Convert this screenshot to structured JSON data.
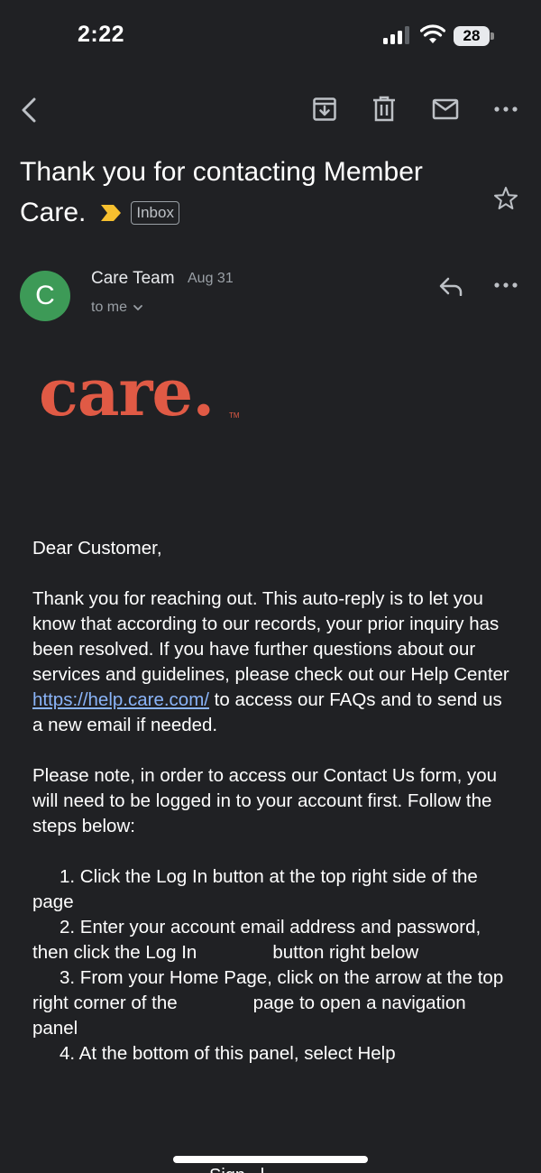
{
  "status_bar": {
    "time": "2:22",
    "battery": "28"
  },
  "toolbar": {
    "back_icon": "chevron-left-icon",
    "archive_icon": "archive-icon",
    "delete_icon": "trash-icon",
    "mark_unread_icon": "mail-icon",
    "more_icon": "more-horizontal-icon"
  },
  "email": {
    "subject_line1": "Thank you for contacting Member",
    "subject_line2": "Care.",
    "label_chip": "Inbox",
    "sender": {
      "initial": "C",
      "name": "Care Team",
      "date": "Aug 31",
      "recipient": "to me"
    },
    "logo_text": "care.",
    "logo_tm": "TM",
    "body": {
      "greeting": "Dear Customer,",
      "p1_before_link": "Thank you for reaching out. This auto-reply is to let you know that according to our records, your prior inquiry has been resolved. If you have further questions about our services and guidelines, please check out our Help Center ",
      "p1_link": "https://help.care.com/",
      "p1_after_link": " to access our FAQs and to send us a new email if needed.",
      "p2": "Please note, in order to access our Contact Us form, you will need to be logged in to your account first. Follow the steps below:",
      "step1": "1. Click the Log In button at the top right side of the page",
      "step2_a": "2. Enter your account email address and password, then click the Log In",
      "step2_b": "button right below",
      "step3_a": "3. From your Home Page, click on the arrow at the top right corner of the",
      "step3_b": "page to open a navigation panel",
      "step4": "4. At the bottom of this panel, select Help"
    },
    "cut_off_text": "Sign ..l"
  },
  "colors": {
    "background": "#202124",
    "avatar": "#3d9a57",
    "logo": "#e05a45",
    "link": "#8ab4f8",
    "label_chevron": "#f6c02f"
  }
}
